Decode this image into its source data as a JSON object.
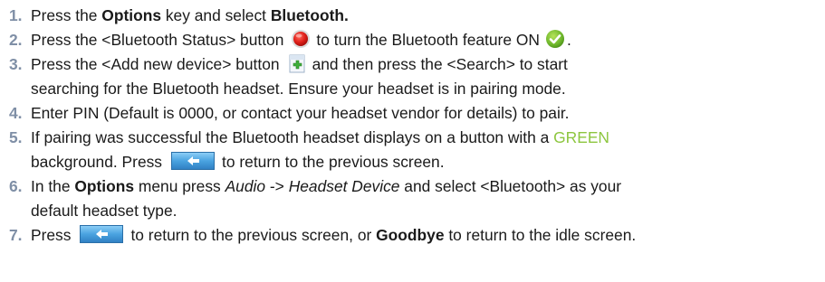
{
  "steps": [
    {
      "num": "1.",
      "a": "Press the ",
      "b": "Options",
      "c": " key and select ",
      "d": "Bluetooth."
    },
    {
      "num": "2.",
      "a": "Press the <Bluetooth Status> button",
      "b": "to turn the Bluetooth feature ON",
      "c": "."
    },
    {
      "num": "3.",
      "a": "Press the <Add new device> button",
      "b": "and then press the <Search> to start",
      "line2": "searching for the Bluetooth headset. Ensure your headset is in pairing mode."
    },
    {
      "num": "4.",
      "a": "Enter PIN (Default is 0000, or contact your headset vendor for details) to pair."
    },
    {
      "num": "5.",
      "a": "If pairing was successful the Bluetooth headset displays on a button with a ",
      "green": "GREEN",
      "line2a": "background. Press",
      "line2b": "to return to the previous screen."
    },
    {
      "num": "6.",
      "a": "In the ",
      "b": "Options",
      "c": " menu press ",
      "d": "Audio",
      "e": " -> ",
      "f": "Headset Device",
      "g": " and select <Bluetooth> as your",
      "line2": "default headset type."
    },
    {
      "num": "7.",
      "a": "Press",
      "b": "to return to the previous screen, or ",
      "c": "Goodbye",
      "d": " to return to the idle screen."
    }
  ],
  "icons": {
    "bluetooth_status": "red-record-button-icon",
    "on_indicator": "green-checkmark-icon",
    "add_device": "add-device-plus-icon",
    "back": "back-arrow-button-icon"
  },
  "colors": {
    "step_number": "#7f8fa6",
    "green_word": "#8dc63f",
    "back_button": "#4aa3e0"
  }
}
